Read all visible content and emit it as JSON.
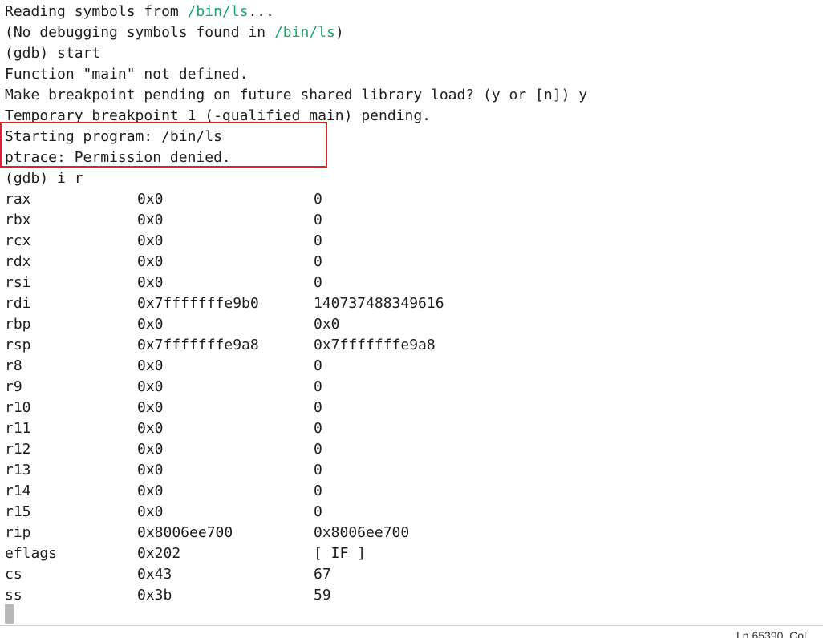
{
  "terminal": {
    "lines": [
      {
        "prefix": "Reading symbols from ",
        "path": "/bin/ls",
        "suffix": "..."
      },
      {
        "prefix": "(No debugging symbols found in ",
        "path": "/bin/ls",
        "suffix": ")"
      },
      {
        "text": "(gdb) start"
      },
      {
        "text": "Function \"main\" not defined."
      },
      {
        "text": "Make breakpoint pending on future shared library load? (y or [n]) y"
      },
      {
        "text": "Temporary breakpoint 1 (-qualified main) pending."
      },
      {
        "text": "Starting program: /bin/ls"
      },
      {
        "text": "ptrace: Permission denied."
      },
      {
        "text": "(gdb) i r"
      }
    ],
    "registers": [
      {
        "name": "rax",
        "hex": "0x0",
        "natural": "0"
      },
      {
        "name": "rbx",
        "hex": "0x0",
        "natural": "0"
      },
      {
        "name": "rcx",
        "hex": "0x0",
        "natural": "0"
      },
      {
        "name": "rdx",
        "hex": "0x0",
        "natural": "0"
      },
      {
        "name": "rsi",
        "hex": "0x0",
        "natural": "0"
      },
      {
        "name": "rdi",
        "hex": "0x7fffffffe9b0",
        "natural": "140737488349616"
      },
      {
        "name": "rbp",
        "hex": "0x0",
        "natural": "0x0"
      },
      {
        "name": "rsp",
        "hex": "0x7fffffffe9a8",
        "natural": "0x7fffffffe9a8"
      },
      {
        "name": "r8",
        "hex": "0x0",
        "natural": "0"
      },
      {
        "name": "r9",
        "hex": "0x0",
        "natural": "0"
      },
      {
        "name": "r10",
        "hex": "0x0",
        "natural": "0"
      },
      {
        "name": "r11",
        "hex": "0x0",
        "natural": "0"
      },
      {
        "name": "r12",
        "hex": "0x0",
        "natural": "0"
      },
      {
        "name": "r13",
        "hex": "0x0",
        "natural": "0"
      },
      {
        "name": "r14",
        "hex": "0x0",
        "natural": "0"
      },
      {
        "name": "r15",
        "hex": "0x0",
        "natural": "0"
      },
      {
        "name": "rip",
        "hex": "0x8006ee700",
        "natural": "0x8006ee700"
      },
      {
        "name": "eflags",
        "hex": "0x202",
        "natural": "[ IF ]"
      },
      {
        "name": "cs",
        "hex": "0x43",
        "natural": "67"
      },
      {
        "name": "ss",
        "hex": "0x3b",
        "natural": "59"
      }
    ]
  },
  "status_bar": {
    "position": "Ln 65390, Col"
  },
  "colors": {
    "path": "#1aa36b",
    "highlight": "#e0202e"
  }
}
